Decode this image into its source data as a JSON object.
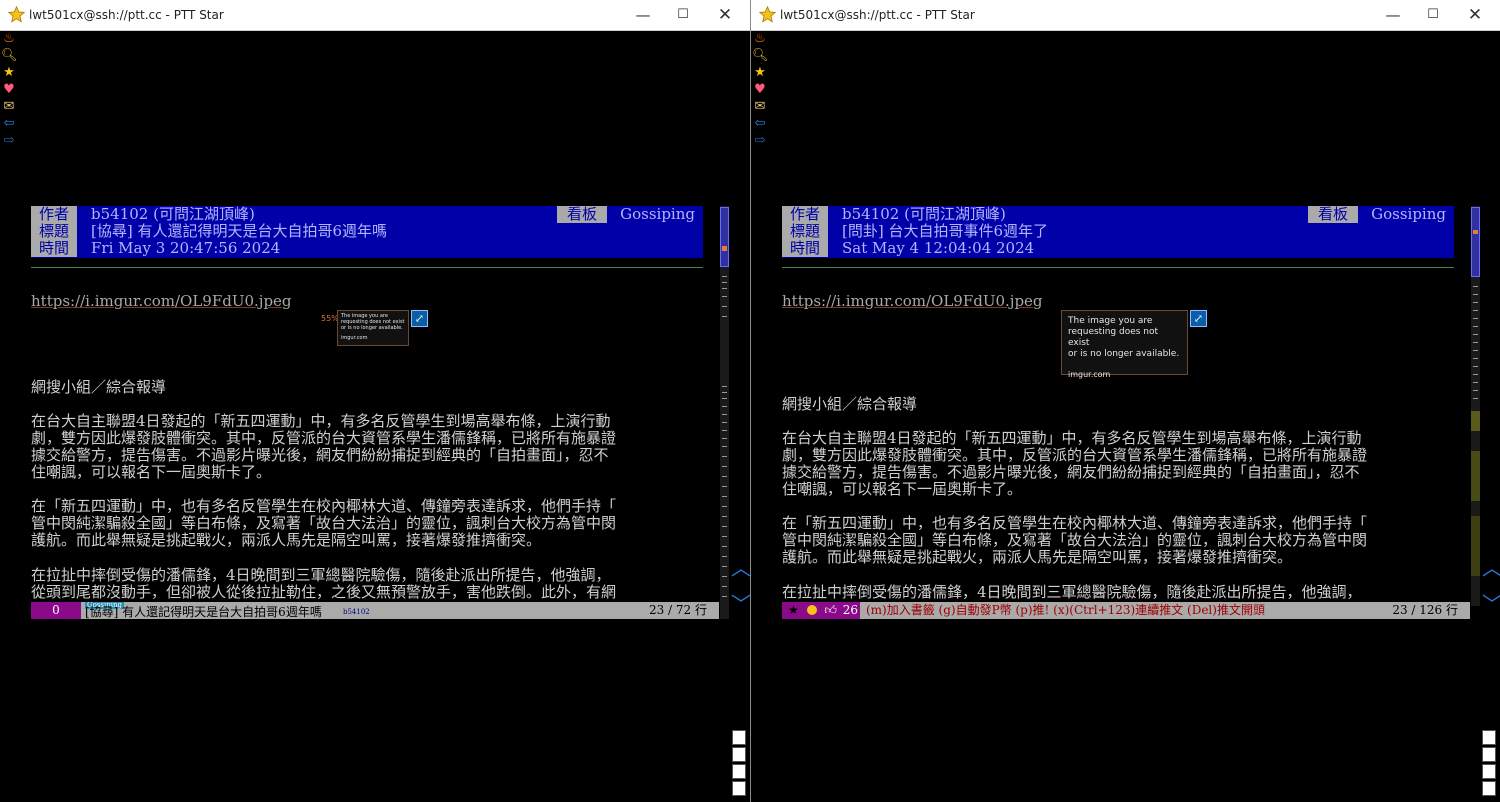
{
  "left": {
    "title": "lwt501cx@ssh://ptt.cc - PTT Star",
    "header": {
      "author_label": "作者",
      "author": "b54102 (可問江湖頂峰)",
      "board_label": "看板",
      "board": "Gossiping",
      "title_label": "標題",
      "post_title": "[協尋] 有人還記得明天是台大自拍哥6週年嗎",
      "time_label": "時間",
      "time": "Fri May  3 20:47:56 2024"
    },
    "link": "https://i.imgur.com/OL9FdU0.jpeg",
    "image_zoom": "55%",
    "image_text": [
      "The image you are",
      "requesting does not exist",
      "or is no longer available."
    ],
    "image_domain": "imgur.com",
    "paragraphs": [
      "網搜小組／綜合報導",
      "在台大自主聯盟4日發起的「新五四運動」中，有多名反管學生到場高舉布條，上演行動\n劇，雙方因此爆發肢體衝突。其中，反管派的台大資管系學生潘儒鋒稱，已將所有施暴證\n據交給警方，提告傷害。不過影片曝光後，網友們紛紛捕捉到經典的「自拍畫面」，忍不\n住嘲諷，可以報名下一屆奧斯卡了。",
      "在「新五四運動」中，也有多名反管學生在校內椰林大道、傳鐘旁表達訴求，他們手持「\n管中閔純潔騙殺全國」等白布條，及寫著「故台大法治」的靈位，諷刺台大校方為管中閔\n護航。而此舉無疑是挑起戰火，兩派人馬先是隔空叫罵，接著爆發推擠衝突。",
      "在拉扯中摔倒受傷的潘儒鋒，4日晚間到三軍總醫院驗傷，隨後赴派出所提告，他強調，\n從頭到尾都沒動手，但卻被人從後拉扯勒住，之後又無預警放手，害他跌倒。此外，有網"
    ],
    "status": {
      "percent": "0",
      "board_tag": "Gossiping",
      "text": "[協尋] 有人還記得明天是台大自拍哥6週年嗎",
      "author_tag": "b54102",
      "lines": "23 / 72 行"
    }
  },
  "right": {
    "title": "lwt501cx@ssh://ptt.cc - PTT Star",
    "header": {
      "author_label": "作者",
      "author": "b54102 (可問江湖頂峰)",
      "board_label": "看板",
      "board": "Gossiping",
      "title_label": "標題",
      "post_title": "[問卦] 台大自拍哥事件6週年了",
      "time_label": "時間",
      "time": "Sat May  4 12:04:04 2024"
    },
    "link": "https://i.imgur.com/OL9FdU0.jpeg",
    "image_text": [
      "The image you are",
      "requesting does not exist",
      "or is no longer available."
    ],
    "image_domain": "imgur.com",
    "paragraphs": [
      "網搜小組／綜合報導",
      "在台大自主聯盟4日發起的「新五四運動」中，有多名反管學生到場高舉布條，上演行動\n劇，雙方因此爆發肢體衝突。其中，反管派的台大資管系學生潘儒鋒稱，已將所有施暴證\n據交給警方，提告傷害。不過影片曝光後，網友們紛紛捕捉到經典的「自拍畫面」，忍不\n住嘲諷，可以報名下一屆奧斯卡了。",
      "在「新五四運動」中，也有多名反管學生在校內椰林大道、傳鐘旁表達訴求，他們手持「\n管中閔純潔騙殺全國」等白布條，及寫著「故台大法治」的靈位，諷刺台大校方為管中閔\n護航。而此舉無疑是挑起戰火，兩派人馬先是隔空叫罵，接著爆發推擠衝突。",
      "在拉扯中摔倒受傷的潘儒鋒，4日晚間到三軍總醫院驗傷，隨後赴派出所提告，他強調，"
    ],
    "status": {
      "count": "26",
      "text": "(m)加入書籤 (g)自動發P幣 (p)推! (x)(Ctrl+123)連續推文 (Del)推文開頭",
      "lines": "23 / 126 行"
    }
  },
  "icons": [
    "fire-icon",
    "search-icon",
    "star-icon",
    "heart-icon",
    "mail-icon",
    "back-arrow-icon",
    "forward-arrow-icon"
  ],
  "colors": {
    "header_bg": "#0000a8",
    "label_bg": "#aaaaaa",
    "status_bg": "#aaaaaa",
    "percent_bg": "#8a0a8a",
    "accent_blue": "#2a7ad6"
  }
}
